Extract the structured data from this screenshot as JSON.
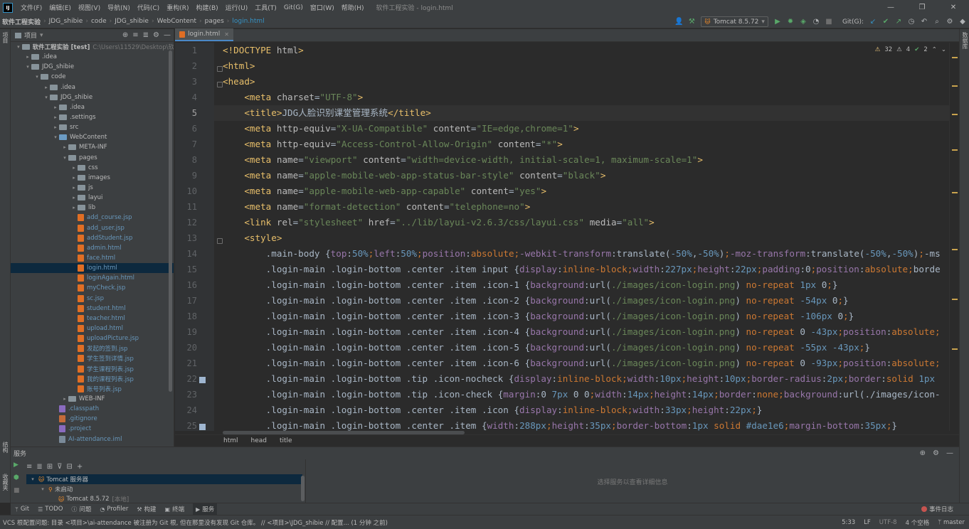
{
  "menubar": {
    "logo": "IJ",
    "items": [
      "文件(F)",
      "编辑(E)",
      "视图(V)",
      "导航(N)",
      "代码(C)",
      "重构(R)",
      "构建(B)",
      "运行(U)",
      "工具(T)",
      "Git(G)",
      "窗口(W)",
      "帮助(H)"
    ],
    "window_title": "软件工程实验 - login.html"
  },
  "navbar": {
    "crumbs": [
      "软件工程实验",
      "JDG_shibie",
      "code",
      "JDG_shibie",
      "WebContent",
      "pages"
    ],
    "file": "login.html",
    "run_config": "Tomcat 8.5.72",
    "git_label": "Git(G):"
  },
  "left_strip": {
    "project": "项目",
    "structure": "结构",
    "favorites": "收藏夹"
  },
  "project_panel": {
    "title": "项目",
    "tree": [
      {
        "indent": 0,
        "arrow": "▾",
        "icon": "folder",
        "label": "软件工程实验 [test]",
        "extra": "C:\\Users\\11529\\Desktop\\软",
        "style": "bold"
      },
      {
        "indent": 1,
        "arrow": "▸",
        "icon": "folder",
        "label": ".idea"
      },
      {
        "indent": 1,
        "arrow": "▾",
        "icon": "folder",
        "label": "JDG_shibie"
      },
      {
        "indent": 2,
        "arrow": "▾",
        "icon": "folder",
        "label": "code"
      },
      {
        "indent": 3,
        "arrow": "▸",
        "icon": "folder",
        "label": ".idea"
      },
      {
        "indent": 3,
        "arrow": "▾",
        "icon": "folder",
        "label": "JDG_shibie"
      },
      {
        "indent": 4,
        "arrow": "▸",
        "icon": "folder",
        "label": ".idea"
      },
      {
        "indent": 4,
        "arrow": "▸",
        "icon": "folder",
        "label": ".settings"
      },
      {
        "indent": 4,
        "arrow": "▸",
        "icon": "folder",
        "label": "src"
      },
      {
        "indent": 4,
        "arrow": "▾",
        "icon": "folder-blue",
        "label": "WebContent"
      },
      {
        "indent": 5,
        "arrow": "▸",
        "icon": "folder",
        "label": "META-INF"
      },
      {
        "indent": 5,
        "arrow": "▾",
        "icon": "folder",
        "label": "pages"
      },
      {
        "indent": 6,
        "arrow": "▸",
        "icon": "folder",
        "label": "css"
      },
      {
        "indent": 6,
        "arrow": "▸",
        "icon": "folder",
        "label": "images"
      },
      {
        "indent": 6,
        "arrow": "▸",
        "icon": "folder",
        "label": "js"
      },
      {
        "indent": 6,
        "arrow": "▸",
        "icon": "folder",
        "label": "layui"
      },
      {
        "indent": 6,
        "arrow": "▸",
        "icon": "folder",
        "label": "lib"
      },
      {
        "indent": 6,
        "arrow": "",
        "icon": "jsp",
        "label": "add_course.jsp",
        "style": "blue"
      },
      {
        "indent": 6,
        "arrow": "",
        "icon": "jsp",
        "label": "add_user.jsp",
        "style": "blue"
      },
      {
        "indent": 6,
        "arrow": "",
        "icon": "jsp",
        "label": "addStudent.jsp",
        "style": "blue"
      },
      {
        "indent": 6,
        "arrow": "",
        "icon": "html",
        "label": "admin.html",
        "style": "blue"
      },
      {
        "indent": 6,
        "arrow": "",
        "icon": "html",
        "label": "face.html",
        "style": "blue"
      },
      {
        "indent": 6,
        "arrow": "",
        "icon": "html",
        "label": "login.html",
        "style": "blue",
        "selected": true
      },
      {
        "indent": 6,
        "arrow": "",
        "icon": "html",
        "label": "loginAgain.html",
        "style": "blue"
      },
      {
        "indent": 6,
        "arrow": "",
        "icon": "jsp",
        "label": "myCheck.jsp",
        "style": "blue"
      },
      {
        "indent": 6,
        "arrow": "",
        "icon": "jsp",
        "label": "sc.jsp",
        "style": "blue"
      },
      {
        "indent": 6,
        "arrow": "",
        "icon": "html",
        "label": "student.html",
        "style": "blue"
      },
      {
        "indent": 6,
        "arrow": "",
        "icon": "html",
        "label": "teacher.html",
        "style": "blue"
      },
      {
        "indent": 6,
        "arrow": "",
        "icon": "html",
        "label": "upload.html",
        "style": "blue"
      },
      {
        "indent": 6,
        "arrow": "",
        "icon": "jsp",
        "label": "uploadPicture.jsp",
        "style": "blue"
      },
      {
        "indent": 6,
        "arrow": "",
        "icon": "jsp",
        "label": "发起的签到.jsp",
        "style": "blue"
      },
      {
        "indent": 6,
        "arrow": "",
        "icon": "jsp",
        "label": "学生签到详情.jsp",
        "style": "blue"
      },
      {
        "indent": 6,
        "arrow": "",
        "icon": "jsp",
        "label": "学生课程列表.jsp",
        "style": "blue"
      },
      {
        "indent": 6,
        "arrow": "",
        "icon": "jsp",
        "label": "我的课程列表.jsp",
        "style": "blue"
      },
      {
        "indent": 6,
        "arrow": "",
        "icon": "jsp",
        "label": "账号列表.jsp",
        "style": "blue"
      },
      {
        "indent": 5,
        "arrow": "▸",
        "icon": "folder",
        "label": "WEB-INF"
      },
      {
        "indent": 4,
        "arrow": "",
        "icon": "cfg",
        "label": ".classpath",
        "style": "blue"
      },
      {
        "indent": 4,
        "arrow": "",
        "icon": "git",
        "label": ".gitignore",
        "style": "blue"
      },
      {
        "indent": 4,
        "arrow": "",
        "icon": "cfg",
        "label": ".project",
        "style": "blue"
      },
      {
        "indent": 4,
        "arrow": "",
        "icon": "iml",
        "label": "AI-attendance.iml",
        "style": "blue"
      }
    ]
  },
  "editor": {
    "tab_label": "login.html",
    "inspection": {
      "warnings": "32",
      "weak": "4",
      "ok": "2"
    },
    "current_line": 5,
    "line_numbers": [
      "1",
      "2",
      "3",
      "4",
      "5",
      "6",
      "7",
      "8",
      "9",
      "10",
      "11",
      "12",
      "13",
      "14",
      "15",
      "16",
      "17",
      "18",
      "19",
      "20",
      "21",
      "22",
      "23",
      "24",
      "25"
    ],
    "code_lines": [
      "<!DOCTYPE html>",
      "<html>",
      "<head>",
      "    <meta charset=\"UTF-8\">",
      "    <title>JDG人脸识别课堂管理系统</title>",
      "    <meta http-equiv=\"X-UA-Compatible\" content=\"IE=edge,chrome=1\">",
      "    <meta http-equiv=\"Access-Control-Allow-Origin\" content=\"*\">",
      "    <meta name=\"viewport\" content=\"width=device-width, initial-scale=1, maximum-scale=1\">",
      "    <meta name=\"apple-mobile-web-app-status-bar-style\" content=\"black\">",
      "    <meta name=\"apple-mobile-web-app-capable\" content=\"yes\">",
      "    <meta name=\"format-detection\" content=\"telephone=no\">",
      "    <link rel=\"stylesheet\" href=\"../lib/layui-v2.6.3/css/layui.css\" media=\"all\">",
      "    <style>",
      "        .main-body {top:50%;left:50%;position:absolute;-webkit-transform:translate(-50%,-50%);-moz-transform:translate(-50%,-50%);-ms",
      "        .login-main .login-bottom .center .item input {display:inline-block;width:227px;height:22px;padding:0;position:absolute;borde",
      "        .login-main .login-bottom .center .item .icon-1 {background:url(./images/icon-login.png) no-repeat 1px 0;}",
      "        .login-main .login-bottom .center .item .icon-2 {background:url(./images/icon-login.png) no-repeat -54px 0;}",
      "        .login-main .login-bottom .center .item .icon-3 {background:url(./images/icon-login.png) no-repeat -106px 0;}",
      "        .login-main .login-bottom .center .item .icon-4 {background:url(./images/icon-login.png) no-repeat 0 -43px;position:absolute;",
      "        .login-main .login-bottom .center .item .icon-5 {background:url(./images/icon-login.png) no-repeat -55px -43px;}",
      "        .login-main .login-bottom .center .item .icon-6 {background:url(./images/icon-login.png) no-repeat 0 -93px;position:absolute;",
      "        .login-main .login-bottom .tip .icon-nocheck {display:inline-block;width:10px;height:10px;border-radius:2px;border:solid 1px",
      "        .login-main .login-bottom .tip .icon-check {margin:0 7px 0 0;width:14px;height:14px;border:none;background:url(./images/icon-",
      "        .login-main .login-bottom .center .item .icon {display:inline-block;width:33px;height:22px;}",
      "        .login-main .login-bottom .center .item {width:288px;height:35px;border-bottom:1px solid #dae1e6;margin-bottom:35px;}"
    ],
    "breadcrumb": [
      "html",
      "head",
      "title"
    ]
  },
  "services": {
    "title": "服务",
    "tree": [
      {
        "label": "Tomcat 服务器",
        "selected": true,
        "indent": 0
      },
      {
        "label": "未启动",
        "selected": false,
        "indent": 1
      },
      {
        "label": "Tomcat 8.5.72",
        "sub": "[本地]",
        "selected": false,
        "indent": 2
      }
    ],
    "detail_placeholder": "选择服务以查看详细信息"
  },
  "tool_tabs": [
    "Git",
    "TODO",
    "问题",
    "Profiler",
    "构建",
    "终端",
    "服务"
  ],
  "event_log": "事件日志",
  "statusbar": {
    "message": "VCS 根配置问题: 目录 <项目>\\ai-attendance 被注册为 Git 根, 但在那里没有发现 Git 仓库。 // <项目>\\JDG_shibie // 配置... (1 分钟 之前)",
    "position": "5:33",
    "line_sep": "LF",
    "encoding": "UTF-8",
    "indent": "4 个空格",
    "branch": "master"
  },
  "colors": {
    "accent": "#3592c4",
    "selection": "#0d293e",
    "background": "#2b2b2b",
    "panel": "#3c3f41"
  }
}
